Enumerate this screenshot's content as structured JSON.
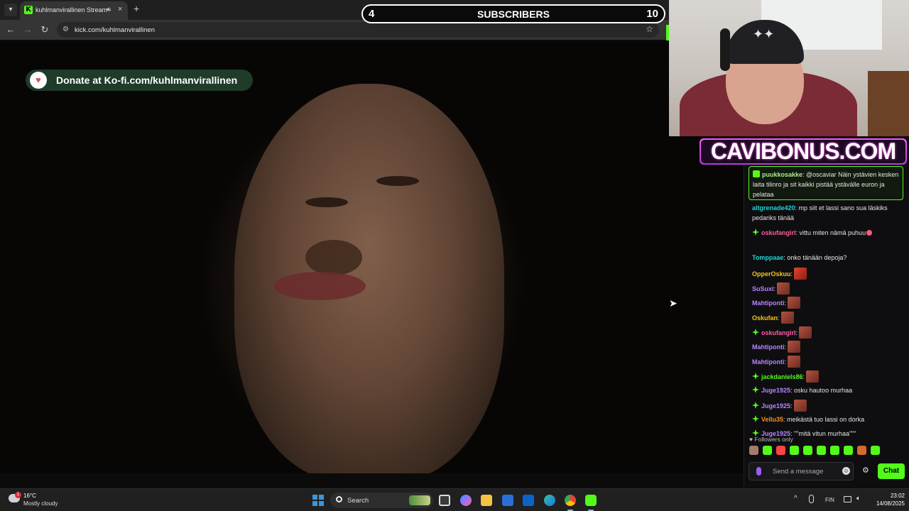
{
  "browser": {
    "tab_title": "kuhlmanvirallinen Stream -",
    "tab_favicon": "K",
    "url": "kick.com/kuhlmanvirallinen"
  },
  "overlay": {
    "subs_left": "4",
    "subs_label": "SUBSCRIBERS",
    "subs_right": "10",
    "donate_text": "Donate at Ko-fi.com/kuhlmanvirallinen",
    "banner": "CAVIBONUS.COM"
  },
  "chat": {
    "pinned": {
      "user": "puukkosakke",
      "text": ": @oscaviar Näin ystävien kesken laita tilinro ja sit kaikki pistää ystävälle euron ja pelataa"
    },
    "messages": [
      {
        "user": "altgrenade420",
        "text": ": mp siit et lassi sano sua läskiks pedariks tänää",
        "color": "#1ed6d6",
        "badge": "none",
        "emote": false
      },
      {
        "user": "oskufangirl",
        "text": ": vittu miten nämä puhuu",
        "color": "#ff5ba3",
        "badge": "star",
        "emote": false
      },
      {
        "user": "Tomppaae",
        "text": ": onko tänään depoja?",
        "color": "#1ed6d6",
        "badge": "none",
        "emote": false
      },
      {
        "user": "OpperOskuu",
        "text": ":",
        "color": "#f5c518",
        "badge": "none",
        "emote": true
      },
      {
        "user": "SuSuxi",
        "text": ":",
        "color": "#b784ff",
        "badge": "none",
        "emote": true
      },
      {
        "user": "Mahtiponti",
        "text": ":",
        "color": "#b784ff",
        "badge": "none",
        "emote": true
      },
      {
        "user": "Oskufan",
        "text": ":",
        "color": "#f5c518",
        "badge": "none",
        "emote": true
      },
      {
        "user": "oskufangirl",
        "text": ":",
        "color": "#ff5ba3",
        "badge": "star",
        "emote": true
      },
      {
        "user": "Mahtiponti",
        "text": ":",
        "color": "#b784ff",
        "badge": "none",
        "emote": true
      },
      {
        "user": "Mahtiponti",
        "text": ":",
        "color": "#b784ff",
        "badge": "none",
        "emote": true
      },
      {
        "user": "jackdaniels86",
        "text": ":",
        "color": "#53fc18",
        "badge": "star",
        "emote": true
      },
      {
        "user": "Juge1925",
        "text": ": osku hautoo murhaa",
        "color": "#b784ff",
        "badge": "star",
        "emote": false
      },
      {
        "user": "Juge1925",
        "text": ":",
        "color": "#b784ff",
        "badge": "star",
        "emote": true
      },
      {
        "user": "Vellu35",
        "text": ": meikästä tuo lassi on dorka",
        "color": "#ff8c1a",
        "badge": "star",
        "emote": false
      },
      {
        "user": "Juge1925",
        "text": ": \"\"mitä vitun murhaa\"\"\"",
        "color": "#b784ff",
        "badge": "star",
        "emote": false
      }
    ],
    "followers_only": "Followers only",
    "input_placeholder": "Send a message",
    "send_label": "Chat"
  },
  "taskbar": {
    "temperature": "16°C",
    "weather": "Mostly cloudy",
    "weather_alert": "1",
    "search_label": "Search",
    "language": "FIN",
    "time": "23:02",
    "date": "14/08/2025"
  },
  "colors": {
    "kick_green": "#53fc18",
    "banner_pink": "#ff56ff",
    "subscriber_bar": "#0a0a0a"
  },
  "icons": [
    "search-icon",
    "microphone-icon",
    "gear-icon",
    "star-bookmark-icon",
    "kofi-cup-icon",
    "windows-start-icon"
  ]
}
